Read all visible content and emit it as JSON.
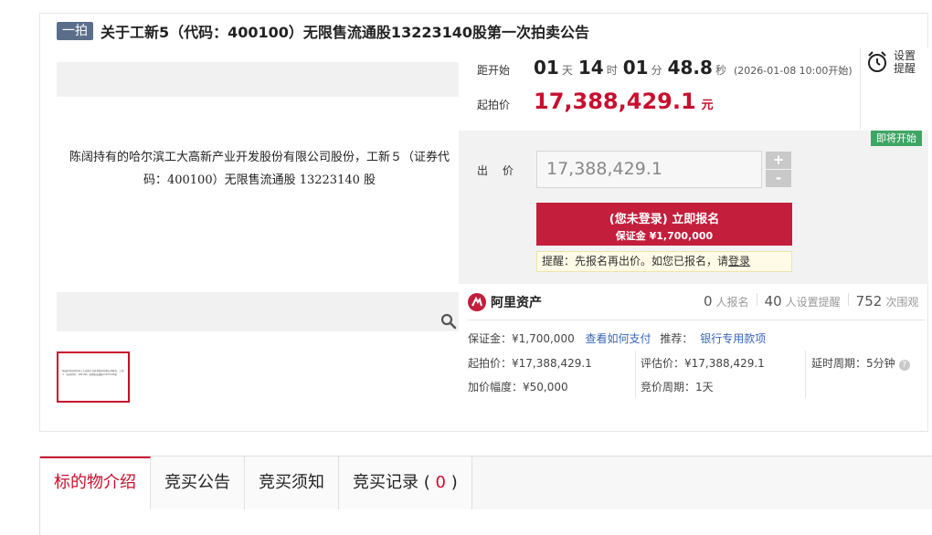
{
  "title": {
    "badge": "一拍",
    "text": "关于工新5（代码：400100）无限售流通股13223140股第一次拍卖公告"
  },
  "gallery": {
    "doc_text": "陈阔持有的哈尔滨工大高新产业开发股份有限公司股份，工新５（证券代码：400100）无限售流通股 13223140 股",
    "thumb_text": "陈阔持有的哈尔滨工大高新产业开发股份有限公司股份，工新５（证券代码：400100）无限售流通股13223140股",
    "zoom_icon": "magnifier-icon"
  },
  "countdown": {
    "label": "距开始",
    "days": "01",
    "days_unit": "天",
    "hours": "14",
    "hours_unit": "时",
    "minutes": "01",
    "minutes_unit": "分",
    "seconds": "48.8",
    "seconds_unit": "秒",
    "start_time": "(2026-01-08 10:00开始)"
  },
  "start_price": {
    "label": "起拍价",
    "value": "17,388,429.1",
    "unit": "元"
  },
  "reminder": {
    "icon": "alarm-clock-icon",
    "line1": "设置",
    "line2": "提醒"
  },
  "status_tag": "即将开始",
  "bid": {
    "label": "出 价",
    "input_value": "17,388,429.1",
    "plus": "+",
    "minus": "-",
    "signup_line1": "(您未登录) 立即报名",
    "signup_line2": "保证金 ¥1,700,000",
    "tip_prefix": "提醒：先报名再出价。如您已报名，请",
    "tip_link": "登录"
  },
  "platform": {
    "name": "阿里资产",
    "stats": [
      {
        "num": "0",
        "label": "人报名"
      },
      {
        "num": "40",
        "label": "人设置提醒"
      },
      {
        "num": "752",
        "label": "次围观"
      }
    ]
  },
  "details": {
    "deposit": "保证金：¥1,700,000",
    "how_to_pay": "查看如何支付",
    "recommend_label": "推荐：",
    "recommend_link": "银行专用款项",
    "start_price": "起拍价：¥17,388,429.1",
    "eval_price": "评估价：¥17,388,429.1",
    "delay": "延时周期：5分钟",
    "increment": "加价幅度：¥50,000",
    "cycle": "竞价周期：1天"
  },
  "tabs": [
    {
      "label": "标的物介绍"
    },
    {
      "label": "竞买公告"
    },
    {
      "label": "竞买须知"
    },
    {
      "label": "竞买记录",
      "count": "0"
    }
  ],
  "colors": {
    "accent": "#c8102e",
    "button": "#c31e3c",
    "status_green": "#3fa564",
    "link_blue": "#3866b8"
  }
}
